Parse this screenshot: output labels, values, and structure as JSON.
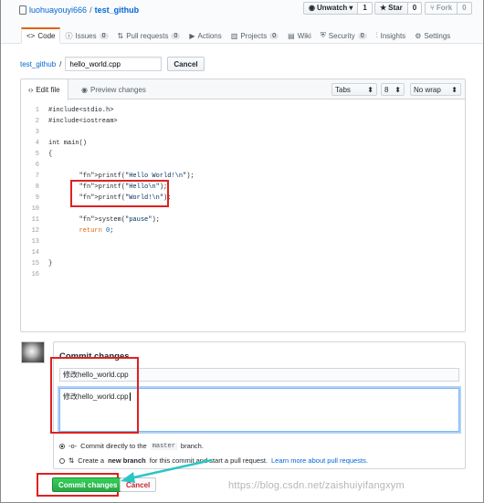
{
  "repo": {
    "owner": "luohuayouyi666",
    "separator": "/",
    "name": "test_github"
  },
  "actions": {
    "watch": {
      "label": "Unwatch",
      "count": "1"
    },
    "star": {
      "label": "Star",
      "count": "0"
    },
    "fork": {
      "label": "Fork",
      "count": "0"
    }
  },
  "tabs": [
    {
      "label": "Code",
      "icon": "<>",
      "count": null
    },
    {
      "label": "Issues",
      "icon": "ⓘ",
      "count": "0"
    },
    {
      "label": "Pull requests",
      "icon": "⇅",
      "count": "0"
    },
    {
      "label": "Actions",
      "icon": "▶",
      "count": null
    },
    {
      "label": "Projects",
      "icon": "▥",
      "count": "0"
    },
    {
      "label": "Wiki",
      "icon": "▤",
      "count": null
    },
    {
      "label": "Security",
      "icon": "⛨",
      "count": "0"
    },
    {
      "label": "Insights",
      "icon": "⫶",
      "count": null
    },
    {
      "label": "Settings",
      "icon": "⚙",
      "count": null
    }
  ],
  "breadcrumb": {
    "repo": "test_github",
    "sep": "/",
    "filename": "hello_world.cpp",
    "cancel": "Cancel"
  },
  "editor": {
    "tab_edit": "Edit file",
    "tab_preview": "Preview changes",
    "indent_mode": "Tabs",
    "indent_size": "8",
    "wrap_mode": "No wrap",
    "lines": [
      {
        "n": "1",
        "t": "#include<stdio.h>"
      },
      {
        "n": "2",
        "t": "#include<iostream>"
      },
      {
        "n": "3",
        "t": ""
      },
      {
        "n": "4",
        "t": "int main()"
      },
      {
        "n": "5",
        "t": "{"
      },
      {
        "n": "6",
        "t": ""
      },
      {
        "n": "7",
        "t": "        printf(\"Hello World!\\n\");"
      },
      {
        "n": "8",
        "t": "        printf(\"Hello\\n\");"
      },
      {
        "n": "9",
        "t": "        printf(\"World!\\n\");"
      },
      {
        "n": "10",
        "t": ""
      },
      {
        "n": "11",
        "t": "        system(\"pause\");"
      },
      {
        "n": "12",
        "t": "        return 0;"
      },
      {
        "n": "13",
        "t": ""
      },
      {
        "n": "14",
        "t": ""
      },
      {
        "n": "15",
        "t": "}"
      },
      {
        "n": "16",
        "t": ""
      }
    ]
  },
  "commit": {
    "heading": "Commit changes",
    "summary": "修改hello_world.cpp",
    "description": "修改hello_world.cpp",
    "option_direct_pre": "Commit directly to the",
    "option_direct_branch": "master",
    "option_direct_post": "branch.",
    "option_new_pre": "Create a",
    "option_new_bold": "new branch",
    "option_new_post": "for this commit and start a pull request.",
    "option_new_link": "Learn more about pull requests.",
    "commit_button": "Commit changes",
    "cancel_button": "Cancel"
  },
  "watermark": "https://blog.csdn.net/zaishuiyifangxym",
  "colors": {
    "accent": "#e36209",
    "link": "#0366d6",
    "commit_green": "#28a745",
    "annotation_red": "#e02020",
    "annotation_arrow": "#2bc5c5"
  }
}
